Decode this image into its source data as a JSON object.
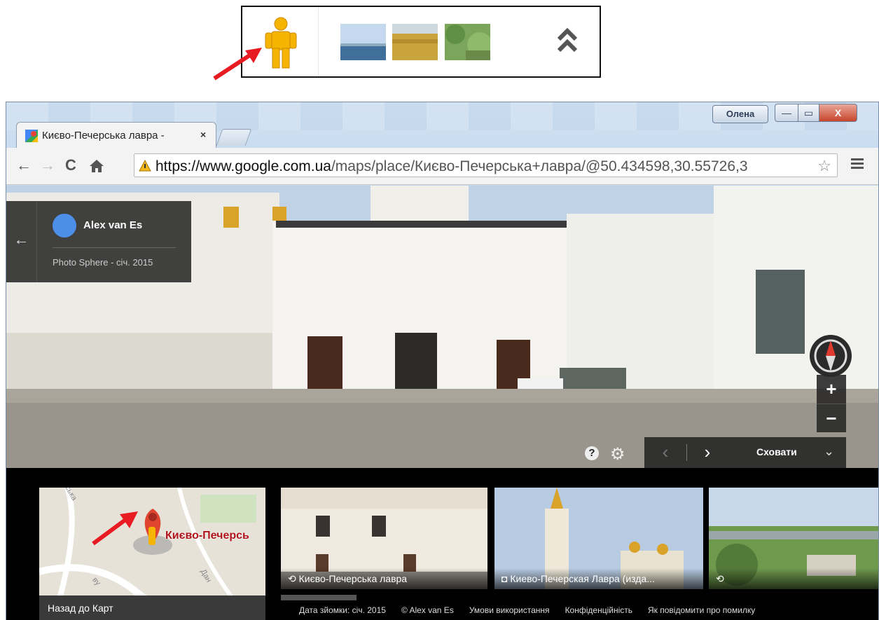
{
  "browser": {
    "tab_title": "Києво-Печерська лавра -",
    "tab_close": "×",
    "user_name": "Олена",
    "url_host": "https://www.google.com.ua",
    "url_path": "/maps/place/Києво-Печерська+лавра/@50.434598,30.55726,3",
    "window_min": "—",
    "window_max": "▭",
    "window_close": "X"
  },
  "streetview": {
    "author": "Alex van Es",
    "subtitle": "Photo Sphere - січ. 2015",
    "zoom_in": "+",
    "zoom_out": "−",
    "help": "?",
    "hide_label": "Сховати",
    "prev": "‹",
    "next": "›"
  },
  "map": {
    "place_label": "Києво-Печерсь",
    "back_to_maps": "Назад до Карт",
    "street_1": "ська",
    "street_2": "ву",
    "street_3": "Дан"
  },
  "photos": [
    {
      "caption": "Києво-Печерська лавра",
      "icon": "360-icon"
    },
    {
      "caption": "Киево-Печерская Лавра (изда...",
      "icon": "camera-icon"
    },
    {
      "caption": "",
      "icon": "360-icon"
    }
  ],
  "footer": {
    "date": "Дата зйомки: січ. 2015",
    "copyright": "© Alex van Es",
    "terms": "Умови використання",
    "privacy": "Конфіденційність",
    "report": "Як повідомити про помилку"
  },
  "colors": {
    "arrow": "#e81b23",
    "pegman": "#f5b400",
    "accent_red": "#b0131a"
  }
}
